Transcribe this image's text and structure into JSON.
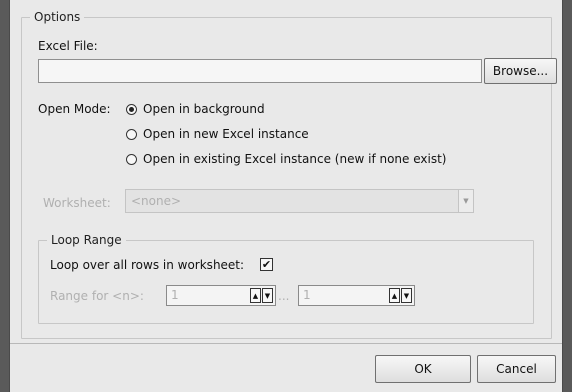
{
  "options": {
    "legend": "Options",
    "excel_file_label": "Excel File:",
    "excel_file_value": "",
    "browse_label": "Browse...",
    "open_mode_label": "Open Mode:",
    "open_modes": [
      {
        "label": "Open in background",
        "checked": true
      },
      {
        "label": "Open in new Excel instance",
        "checked": false
      },
      {
        "label": "Open in existing Excel instance (new if none exist)",
        "checked": false
      }
    ],
    "worksheet_label": "Worksheet:",
    "worksheet_value": "<none>"
  },
  "loop_range": {
    "legend": "Loop Range",
    "loop_all_label": "Loop over all rows in worksheet:",
    "loop_all_checked": true,
    "range_label": "Range for <n>:",
    "range_from": "1",
    "range_sep": "...",
    "range_to": "1"
  },
  "footer": {
    "ok_label": "OK",
    "cancel_label": "Cancel"
  }
}
